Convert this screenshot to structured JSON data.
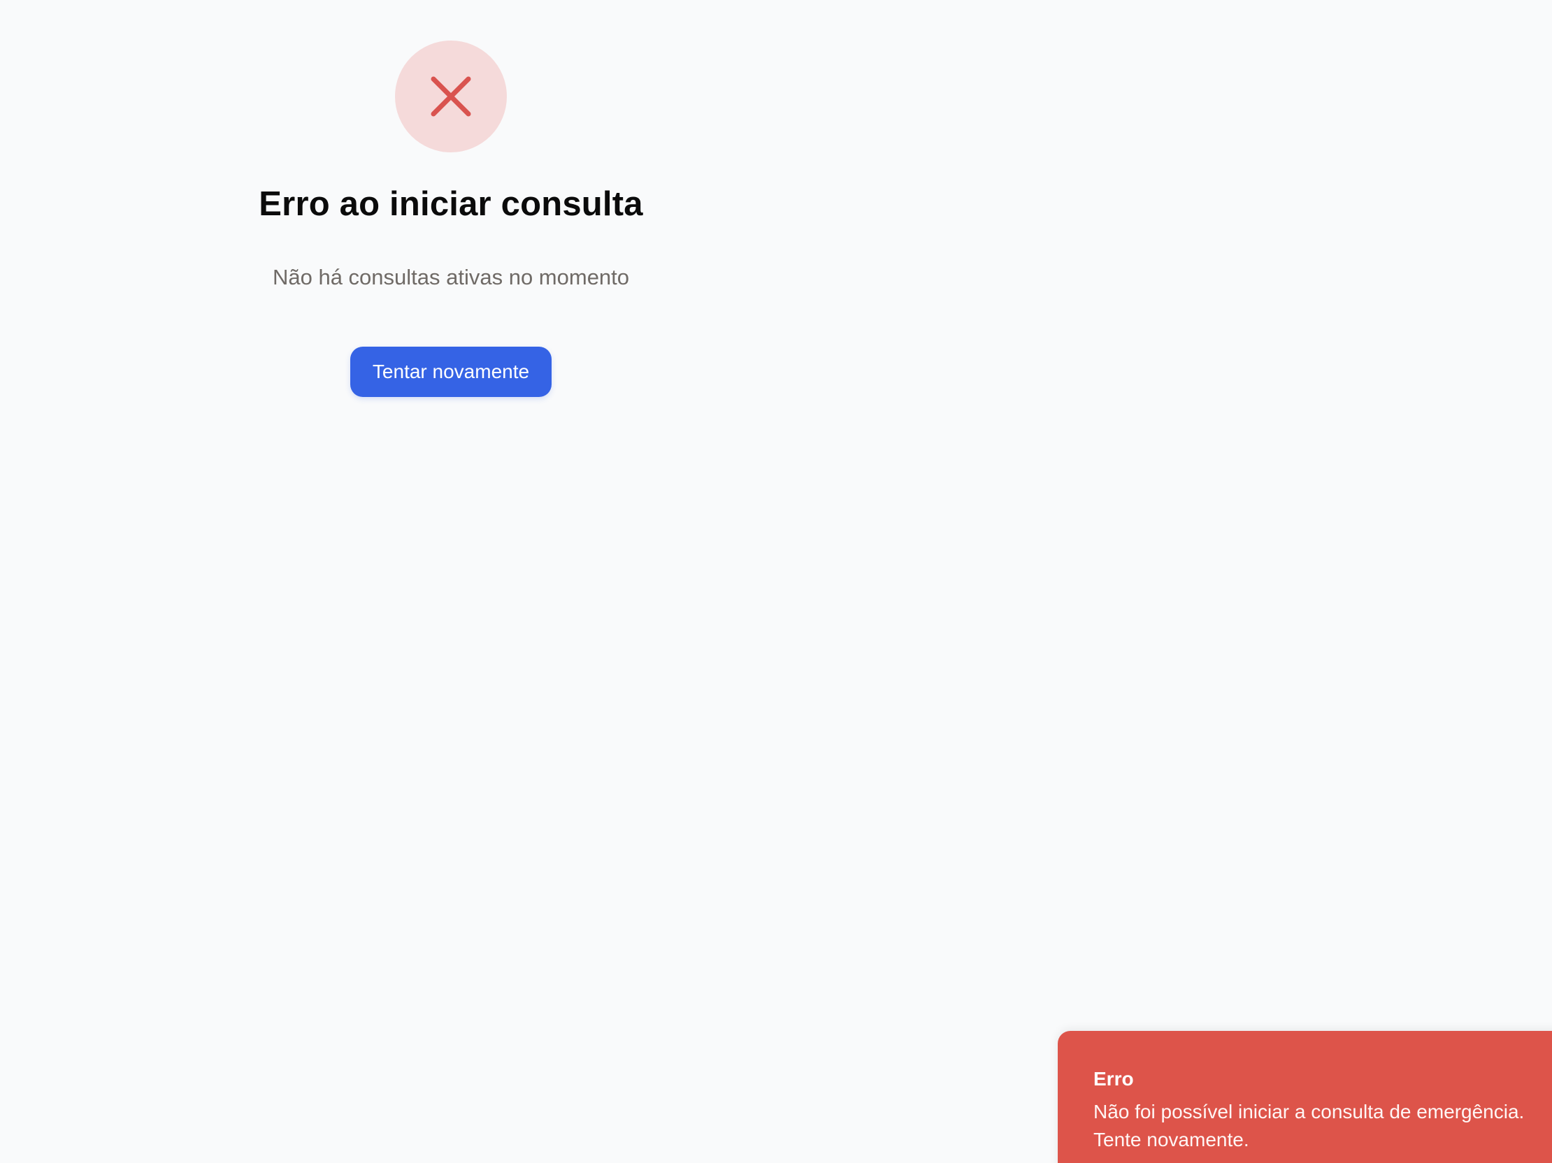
{
  "error_state": {
    "icon": "close-icon",
    "title": "Erro ao iniciar consulta",
    "subtitle": "Não há consultas ativas no momento",
    "retry_label": "Tentar novamente"
  },
  "toast": {
    "title": "Erro",
    "message": "Não foi possível iniciar a consulta de emergência. Tente novamente."
  },
  "colors": {
    "background": "#f9fafb",
    "error_icon_background": "#f5dada",
    "error_icon": "#d9534f",
    "primary_button": "#3563e5",
    "toast_background": "#dd544a"
  }
}
